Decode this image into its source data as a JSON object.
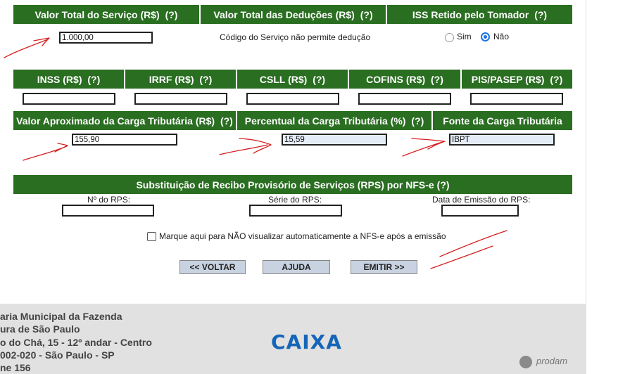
{
  "headers_row1": {
    "valor_total": "Valor Total do Serviço (R$)",
    "deducoes": "Valor Total das Deduções (R$)",
    "iss_retido": "ISS Retido pelo Tomador",
    "help": "(?)"
  },
  "valor_total_value": "1.000,00",
  "deducao_notice": "Código do Serviço não permite dedução",
  "iss_options": {
    "sim": "Sim",
    "nao": "Não",
    "selected": "Não"
  },
  "headers_row2": {
    "inss": "INSS (R$)",
    "irrf": "IRRF (R$)",
    "csll": "CSLL (R$)",
    "cofins": "COFINS (R$)",
    "pispasep": "PIS/PASEP (R$)"
  },
  "headers_row3": {
    "carga_valor": "Valor Aproximado da Carga Tributária (R$)",
    "carga_percent": "Percentual da Carga Tributária (%)",
    "carga_fonte": "Fonte da Carga Tributária"
  },
  "carga_values": {
    "valor": "155,90",
    "percent": "15,59",
    "fonte": "IBPT"
  },
  "rps": {
    "title": "Substituição de Recibo Provisório de Serviços (RPS) por NFS-e",
    "numero_label": "Nº do RPS:",
    "serie_label": "Série do RPS:",
    "data_label": "Data de Emissão do RPS:"
  },
  "checkbox_label": "Marque aqui para NÃO visualizar automaticamente a NFS-e após a emissão",
  "buttons": {
    "voltar": "<< VOLTAR",
    "ajuda": "AJUDA",
    "emitir": "EMITIR >>"
  },
  "footer": {
    "lines": [
      "aria Municipal da Fazenda",
      "ura de São Paulo",
      "o do Chá, 15 - 12º andar - Centro",
      "002-020 - São Paulo - SP",
      "ne 156"
    ],
    "caixa_logo": "CAIXA",
    "prodam_logo": "prodam"
  },
  "colors": {
    "header_green": "#2a6e21",
    "radio_blue": "#1a73e8",
    "annotation_red": "#d62020"
  }
}
